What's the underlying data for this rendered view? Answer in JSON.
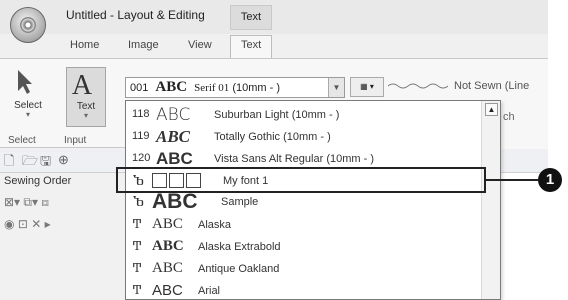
{
  "window": {
    "title": "Untitled - Layout & Editing",
    "context_tab": "Text"
  },
  "tabs": [
    {
      "label": "Home"
    },
    {
      "label": "Image"
    },
    {
      "label": "View"
    },
    {
      "label": "Text"
    }
  ],
  "ribbon": {
    "select_label": "Select",
    "text_label": "Text",
    "group_select": "Select",
    "group_input": "Input",
    "font_selector": {
      "number": "001",
      "sample": "ABC",
      "name": "Serif 01",
      "size": "(10mm - )"
    },
    "sewing": {
      "label": "Not Sewn (Line"
    }
  },
  "search_hint": "ch",
  "pane": {
    "title": "Sewing Order"
  },
  "font_list": [
    {
      "number": "118",
      "sample": "ABC",
      "name": "Suburban Light",
      "size": "(10mm - )"
    },
    {
      "number": "119",
      "sample": "ABC",
      "name": "Totally Gothic",
      "size": "(10mm - )"
    },
    {
      "number": "120",
      "sample": "ABC",
      "name": "Vista Sans Alt Regular",
      "size": "(10mm - )"
    },
    {
      "type_icon": "Ⴆ",
      "name": "My font 1"
    },
    {
      "type_icon": "Ⴆ",
      "sample": "ABC",
      "name": "Sample"
    },
    {
      "type_icon": "Ͳ",
      "sample": "ABC",
      "name": "Alaska"
    },
    {
      "type_icon": "Ͳ",
      "sample": "ABC",
      "name": "Alaska Extrabold"
    },
    {
      "type_icon": "Ͳ",
      "sample": "ABC",
      "name": "Antique Oakland"
    },
    {
      "type_icon": "Ͳ",
      "sample": "ABC",
      "name": "Arial"
    }
  ],
  "callout": {
    "label": "1"
  },
  "colors": {
    "highlight_border": "#222222",
    "ribbon_bg": "#f7f7f7"
  }
}
